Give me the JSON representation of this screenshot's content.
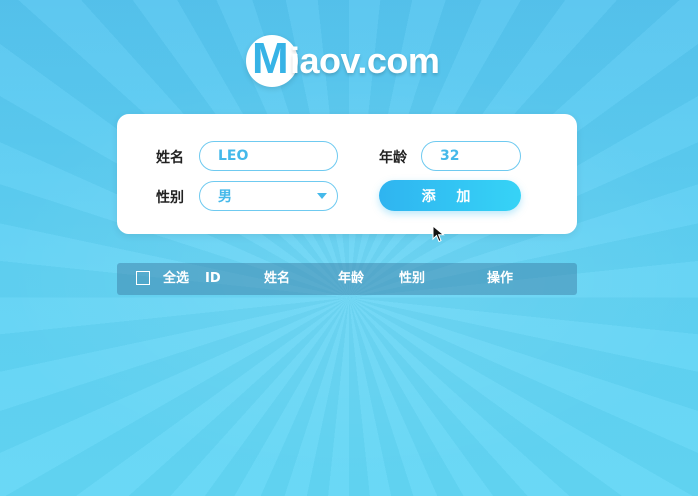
{
  "logo": {
    "m": "M",
    "text": "iaov.com"
  },
  "form": {
    "name_label": "姓名",
    "name_value": "LEO",
    "age_label": "年龄",
    "age_value": "32",
    "gender_label": "性别",
    "gender_value": "男",
    "add_label": "添 加"
  },
  "table": {
    "select_all": "全选",
    "headers": [
      "ID",
      "姓名",
      "年龄",
      "性别",
      "操作"
    ]
  },
  "colors": {
    "background": "#5ccdf2",
    "accent": "#45b9ea",
    "button_start": "#2fb4f0",
    "button_end": "#36d3f6"
  }
}
